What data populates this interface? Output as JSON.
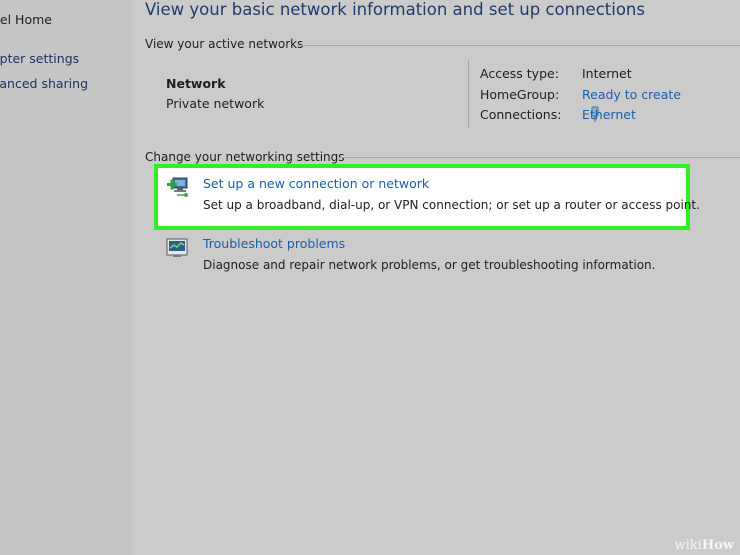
{
  "sidebar": {
    "home_label": "nel Home",
    "adapter_label": "apter settings",
    "advanced_label": "vanced sharing"
  },
  "header": {
    "title": "View your basic network information and set up connections"
  },
  "active_networks": {
    "heading": "View your active networks",
    "network_name": "Network",
    "network_type": "Private network",
    "access_type_label": "Access type:",
    "access_type_value": "Internet",
    "homegroup_label": "HomeGroup:",
    "homegroup_value": "Ready to create",
    "connections_label": "Connections:",
    "connections_value": "Ethernet"
  },
  "networking_settings": {
    "heading": "Change your networking settings",
    "tasks": [
      {
        "title": "Set up a new connection or network",
        "description": "Set up a broadband, dial-up, or VPN connection; or set up a router or access point.",
        "icon": "new-connection-icon"
      },
      {
        "title": "Troubleshoot problems",
        "description": "Diagnose and repair network problems, or get troubleshooting information.",
        "icon": "troubleshoot-icon"
      }
    ]
  },
  "watermark": {
    "prefix": "wiki",
    "suffix": "How"
  },
  "colors": {
    "highlight": "#33ee22",
    "link": "#1b5fa8",
    "title": "#1f3a6e"
  }
}
